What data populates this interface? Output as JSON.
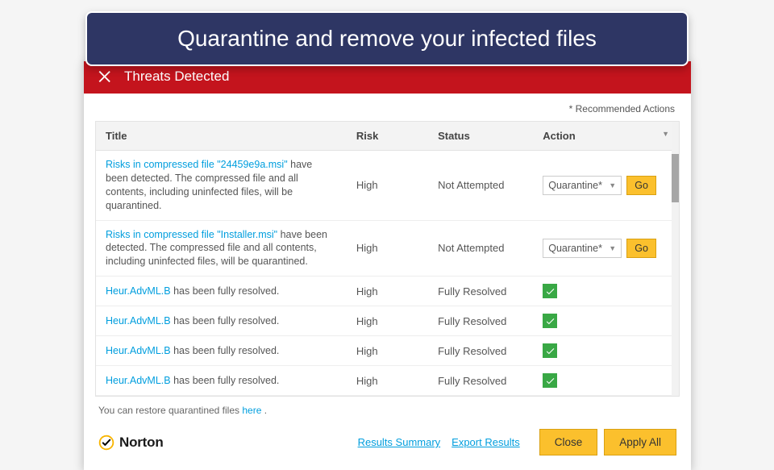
{
  "callout": "Quarantine and remove your infected files",
  "header": {
    "title": "Threats Detected"
  },
  "recommended_note": "* Recommended Actions",
  "columns": {
    "title": "Title",
    "risk": "Risk",
    "status": "Status",
    "action": "Action"
  },
  "rows": [
    {
      "link": "Risks in compressed file \"24459e9a.msi\"",
      "desc_rest": "  have been detected. The compressed file and all contents, including uninfected files, will be quarantined.",
      "risk": "High",
      "status": "Not Attempted",
      "action": "Quarantine*",
      "go": "Go",
      "resolved": false
    },
    {
      "link": "Risks in compressed file \"Installer.msi\"",
      "desc_rest": "  have been detected. The compressed file and all contents, including uninfected files, will be quarantined.",
      "risk": "High",
      "status": "Not Attempted",
      "action": "Quarantine*",
      "go": "Go",
      "resolved": false
    },
    {
      "link": "Heur.AdvML.B",
      "desc_rest": " has been fully resolved.",
      "risk": "High",
      "status": "Fully Resolved",
      "resolved": true
    },
    {
      "link": "Heur.AdvML.B",
      "desc_rest": " has been fully resolved.",
      "risk": "High",
      "status": "Fully Resolved",
      "resolved": true
    },
    {
      "link": "Heur.AdvML.B",
      "desc_rest": " has been fully resolved.",
      "risk": "High",
      "status": "Fully Resolved",
      "resolved": true
    },
    {
      "link": "Heur.AdvML.B",
      "desc_rest": " has been fully resolved.",
      "risk": "High",
      "status": "Fully Resolved",
      "resolved": true
    }
  ],
  "restore": {
    "text": "You can restore quarantined files ",
    "link": "here",
    "suffix": " ."
  },
  "footer": {
    "brand": "Norton",
    "results_summary": "Results Summary",
    "export_results": "Export Results",
    "close": "Close",
    "apply_all": "Apply All"
  }
}
